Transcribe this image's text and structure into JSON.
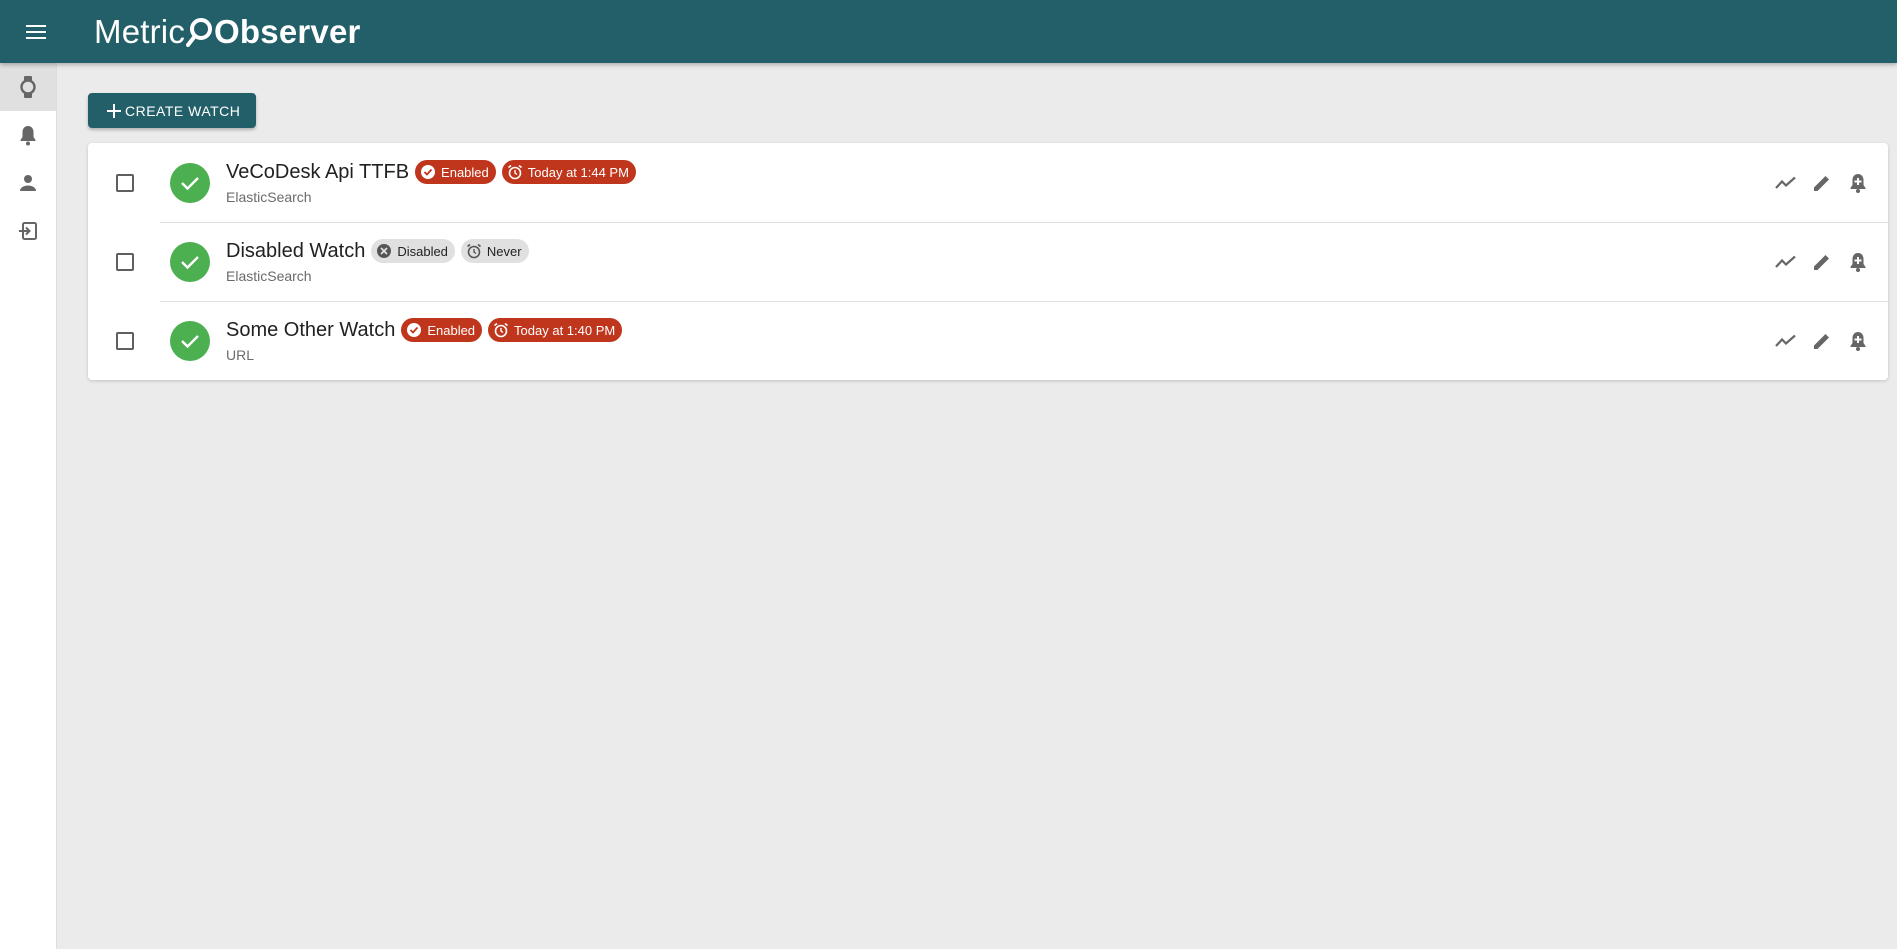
{
  "app": {
    "title_light": "Metric",
    "title_bold": "Observer"
  },
  "sidebar": {
    "items": [
      {
        "icon": "watch-icon",
        "active": true
      },
      {
        "icon": "bell-icon",
        "active": false
      },
      {
        "icon": "person-icon",
        "active": false
      },
      {
        "icon": "logout-icon",
        "active": false
      }
    ]
  },
  "toolbar": {
    "create_label": "CREATE WATCH"
  },
  "watches": [
    {
      "name": "VeCoDesk Api TTFB",
      "type": "ElasticSearch",
      "status_label": "Enabled",
      "schedule_label": "Today at 1:44 PM"
    },
    {
      "name": "Disabled Watch",
      "type": "ElasticSearch",
      "status_label": "Disabled",
      "schedule_label": "Never"
    },
    {
      "name": "Some Other Watch",
      "type": "URL",
      "status_label": "Enabled",
      "schedule_label": "Today at 1:40 PM"
    }
  ],
  "colors": {
    "brand": "#235f68",
    "success": "#4caf50",
    "chip_active": "#c0361c",
    "chip_inactive": "#e0e0e0"
  }
}
